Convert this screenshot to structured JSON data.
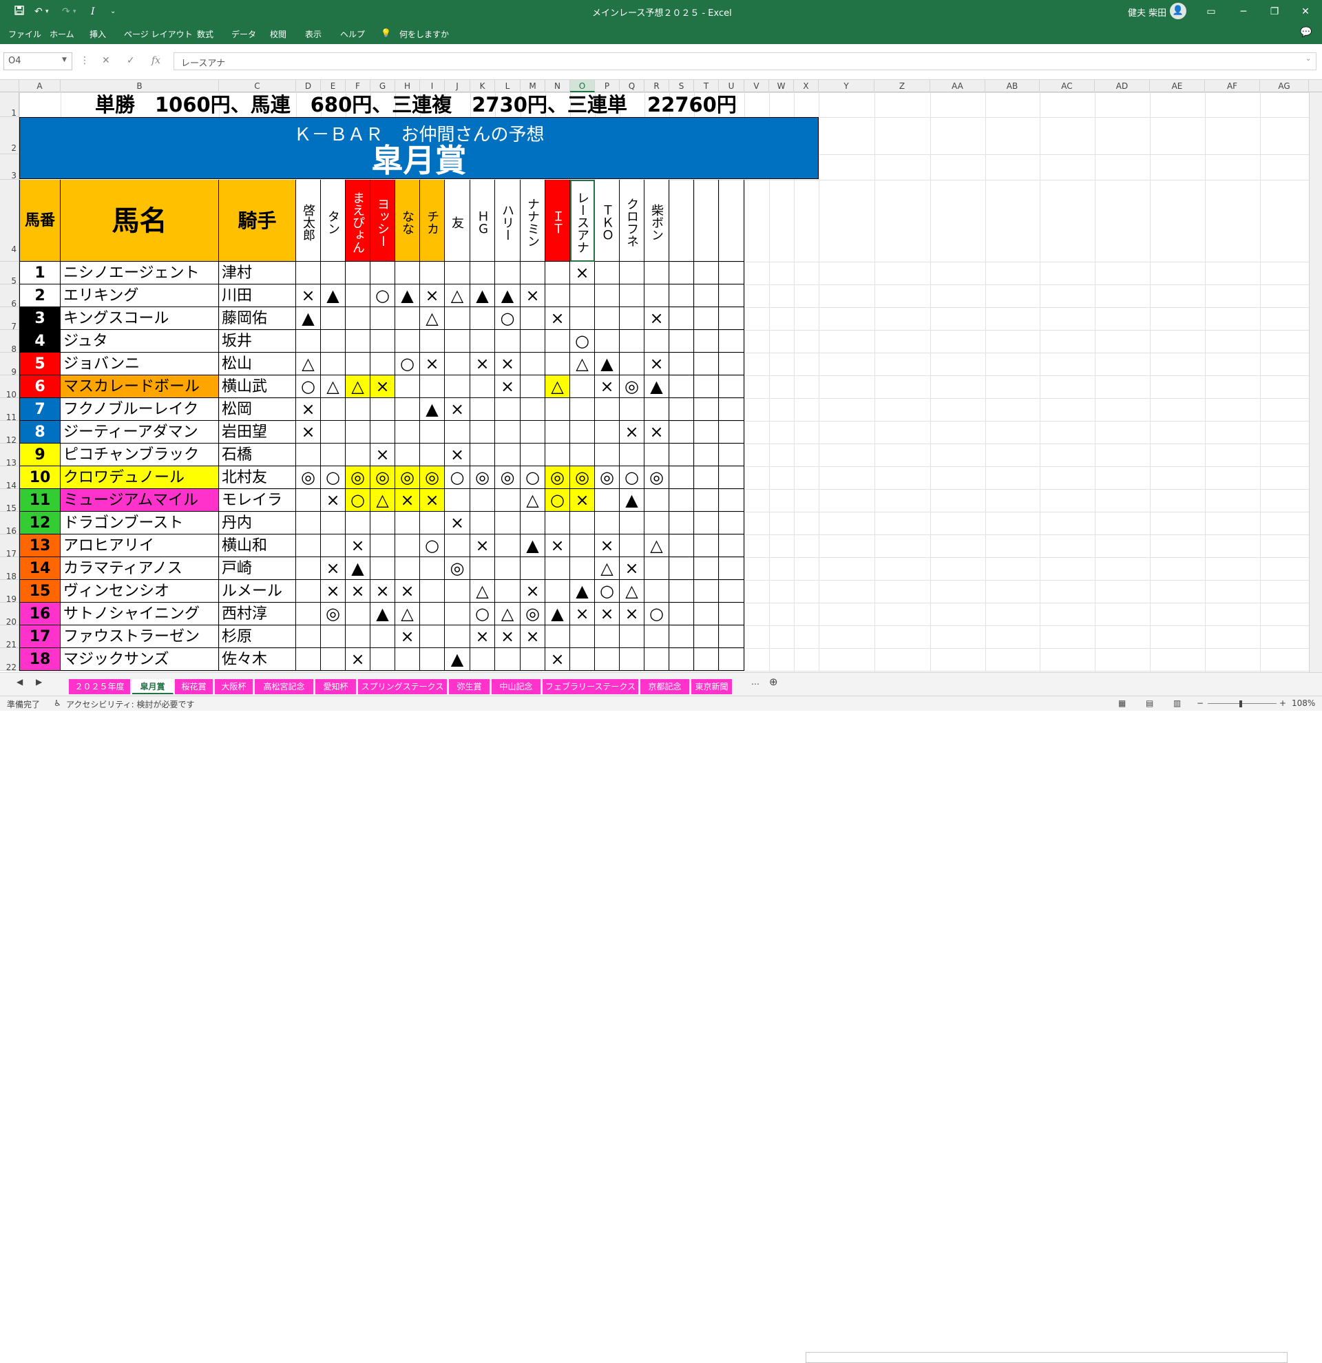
{
  "window": {
    "title": "メインレース予想２０２５ - Excel",
    "user": "健夫 柴田",
    "avatar_icon": "person-icon"
  },
  "qat": {
    "save_icon": "save-icon",
    "undo_icon": "undo-icon",
    "redo_icon": "redo-icon",
    "italic": "I"
  },
  "ribbon_tabs": [
    "ファイル",
    "ホーム",
    "挿入",
    "ページ レイアウト",
    "数式",
    "データ",
    "校閲",
    "表示",
    "ヘルプ",
    "何をしますか"
  ],
  "formula": {
    "name_box": "O4",
    "content": "レースアナ",
    "fx": "fx"
  },
  "columns": [
    "A",
    "B",
    "C",
    "D",
    "E",
    "F",
    "G",
    "H",
    "I",
    "J",
    "K",
    "L",
    "M",
    "N",
    "O",
    "P",
    "Q",
    "R",
    "S",
    "T",
    "U",
    "V",
    "W",
    "X",
    "Y",
    "Z",
    "AA",
    "AB",
    "AC",
    "AD",
    "AE",
    "AF",
    "AG"
  ],
  "rows": [
    "1",
    "2",
    "3",
    "4",
    "5",
    "6",
    "7",
    "8",
    "9",
    "10",
    "11",
    "12",
    "13",
    "14",
    "15",
    "16",
    "17",
    "18",
    "19",
    "20",
    "21",
    "22"
  ],
  "sheet": {
    "result_line": "単勝　1060円、馬連　680円、三連複　2730円、三連単　22760円",
    "subtitle": "Ｋ－ＢＡＲ　お仲間さんの予想",
    "race": "皐月賞",
    "hdr_num": "馬番",
    "hdr_name": "馬名",
    "hdr_jockey": "騎手",
    "predictors": [
      "啓太郎",
      "タン",
      "まえぴょん",
      "ヨッシー",
      "なな",
      "チカ",
      "友",
      "ＨＧ",
      "ハリー",
      "ナナミン",
      "ＩＴ",
      "レースアナ",
      "ＴＫＯ",
      "クロフネ",
      "柴ボン"
    ],
    "predictor_colors": [
      "#ffffff",
      "#ffffff",
      "#ff0000",
      "#ff0000",
      "#ffc000",
      "#ffc000",
      "#ffffff",
      "#ffffff",
      "#ffffff",
      "#ffffff",
      "#ff0000",
      "#ffffff",
      "#ffffff",
      "#ffffff",
      "#ffffff"
    ],
    "horses": [
      {
        "num": "1",
        "name": "ニシノエージェント",
        "jockey": "津村",
        "num_bg": "#ffffff",
        "num_fg": "#000000",
        "name_bg": "#ffffff",
        "marks": [
          "",
          "",
          "",
          "",
          "",
          "",
          "",
          "",
          "",
          "",
          "",
          "×",
          "",
          "",
          ""
        ]
      },
      {
        "num": "2",
        "name": "エリキング",
        "jockey": "川田",
        "num_bg": "#ffffff",
        "num_fg": "#000000",
        "name_bg": "#ffffff",
        "marks": [
          "×",
          "▲",
          "",
          "○",
          "▲",
          "×",
          "△",
          "▲",
          "▲",
          "×",
          "",
          "",
          "",
          "",
          ""
        ]
      },
      {
        "num": "3",
        "name": "キングスコール",
        "jockey": "藤岡佑",
        "num_bg": "#000000",
        "num_fg": "#ffffff",
        "name_bg": "#ffffff",
        "marks": [
          "▲",
          "",
          "",
          "",
          "",
          "△",
          "",
          "",
          "○",
          "",
          "×",
          "",
          "",
          "",
          "×"
        ]
      },
      {
        "num": "4",
        "name": "ジュタ",
        "jockey": "坂井",
        "num_bg": "#000000",
        "num_fg": "#ffffff",
        "name_bg": "#ffffff",
        "marks": [
          "",
          "",
          "",
          "",
          "",
          "",
          "",
          "",
          "",
          "",
          "",
          "○",
          "",
          "",
          ""
        ]
      },
      {
        "num": "5",
        "name": "ジョバンニ",
        "jockey": "松山",
        "num_bg": "#ff0000",
        "num_fg": "#ffffff",
        "name_bg": "#ffffff",
        "marks": [
          "△",
          "",
          "",
          "",
          "○",
          "×",
          "",
          "×",
          "×",
          "",
          "",
          "△",
          "▲",
          "",
          "×"
        ]
      },
      {
        "num": "6",
        "name": "マスカレードボール",
        "jockey": "横山武",
        "num_bg": "#ff0000",
        "num_fg": "#ffffff",
        "name_bg": "#ffa500",
        "marks": [
          "○",
          "△",
          "△",
          "×",
          "",
          "",
          "",
          "",
          "×",
          "",
          "△",
          "",
          "×",
          "◎",
          "▲"
        ]
      },
      {
        "num": "7",
        "name": "フクノブルーレイク",
        "jockey": "松岡",
        "num_bg": "#0070c0",
        "num_fg": "#ffffff",
        "name_bg": "#ffffff",
        "marks": [
          "×",
          "",
          "",
          "",
          "",
          "▲",
          "×",
          "",
          "",
          "",
          "",
          "",
          "",
          "",
          ""
        ]
      },
      {
        "num": "8",
        "name": "ジーティーアダマン",
        "jockey": "岩田望",
        "num_bg": "#0070c0",
        "num_fg": "#ffffff",
        "name_bg": "#ffffff",
        "marks": [
          "×",
          "",
          "",
          "",
          "",
          "",
          "",
          "",
          "",
          "",
          "",
          "",
          "",
          "×",
          "×"
        ]
      },
      {
        "num": "9",
        "name": "ピコチャンブラック",
        "jockey": "石橋",
        "num_bg": "#ffff00",
        "num_fg": "#000000",
        "name_bg": "#ffffff",
        "marks": [
          "",
          "",
          "",
          "×",
          "",
          "",
          "×",
          "",
          "",
          "",
          "",
          "",
          "",
          "",
          ""
        ]
      },
      {
        "num": "10",
        "name": "クロワデュノール",
        "jockey": "北村友",
        "num_bg": "#ffff00",
        "num_fg": "#000000",
        "name_bg": "#ffff00",
        "marks": [
          "◎",
          "○",
          "◎",
          "◎",
          "◎",
          "◎",
          "○",
          "◎",
          "◎",
          "○",
          "◎",
          "◎",
          "◎",
          "○",
          "◎"
        ]
      },
      {
        "num": "11",
        "name": "ミュージアムマイル",
        "jockey": "モレイラ",
        "num_bg": "#33cc33",
        "num_fg": "#000000",
        "name_bg": "#ff33cc",
        "marks": [
          "",
          "×",
          "○",
          "△",
          "×",
          "×",
          "",
          "",
          "",
          "△",
          "○",
          "×",
          "",
          "▲",
          ""
        ]
      },
      {
        "num": "12",
        "name": "ドラゴンブースト",
        "jockey": "丹内",
        "num_bg": "#33cc33",
        "num_fg": "#000000",
        "name_bg": "#ffffff",
        "marks": [
          "",
          "",
          "",
          "",
          "",
          "",
          "×",
          "",
          "",
          "",
          "",
          "",
          "",
          "",
          ""
        ]
      },
      {
        "num": "13",
        "name": "アロヒアリイ",
        "jockey": "横山和",
        "num_bg": "#ff6600",
        "num_fg": "#000000",
        "name_bg": "#ffffff",
        "marks": [
          "",
          "",
          "×",
          "",
          "",
          "○",
          "",
          "×",
          "",
          "▲",
          "×",
          "",
          "×",
          "",
          "△"
        ]
      },
      {
        "num": "14",
        "name": "カラマティアノス",
        "jockey": "戸崎",
        "num_bg": "#ff6600",
        "num_fg": "#000000",
        "name_bg": "#ffffff",
        "marks": [
          "",
          "×",
          "▲",
          "",
          "",
          "",
          "◎",
          "",
          "",
          "",
          "",
          "",
          "△",
          "×",
          ""
        ]
      },
      {
        "num": "15",
        "name": "ヴィンセンシオ",
        "jockey": "ルメール",
        "num_bg": "#ff6600",
        "num_fg": "#000000",
        "name_bg": "#ffffff",
        "marks": [
          "",
          "×",
          "×",
          "×",
          "×",
          "",
          "",
          "△",
          "",
          "×",
          "",
          "▲",
          "○",
          "△",
          ""
        ]
      },
      {
        "num": "16",
        "name": "サトノシャイニング",
        "jockey": "西村淳",
        "num_bg": "#ff33cc",
        "num_fg": "#000000",
        "name_bg": "#ffffff",
        "marks": [
          "",
          "◎",
          "",
          "▲",
          "△",
          "",
          "",
          "○",
          "△",
          "◎",
          "▲",
          "×",
          "×",
          "×",
          "○"
        ]
      },
      {
        "num": "17",
        "name": "ファウストラーゼン",
        "jockey": "杉原",
        "num_bg": "#ff33cc",
        "num_fg": "#000000",
        "name_bg": "#ffffff",
        "marks": [
          "",
          "",
          "",
          "",
          "×",
          "",
          "",
          "×",
          "×",
          "×",
          "",
          "",
          "",
          "",
          ""
        ]
      },
      {
        "num": "18",
        "name": "マジックサンズ",
        "jockey": "佐々木",
        "num_bg": "#ff33cc",
        "num_fg": "#000000",
        "name_bg": "#ffffff",
        "marks": [
          "",
          "",
          "×",
          "",
          "",
          "",
          "▲",
          "",
          "",
          "",
          "×",
          "",
          "",
          "",
          ""
        ]
      }
    ],
    "highlights": [
      {
        "row": 5,
        "cols": [
          2,
          3
        ]
      },
      {
        "row": 5,
        "cols": [
          10
        ]
      },
      {
        "row": 9,
        "cols": [
          2,
          3,
          4,
          5,
          10,
          11
        ]
      },
      {
        "row": 10,
        "cols": [
          2,
          3,
          4,
          5,
          10,
          11
        ]
      }
    ]
  },
  "sheet_tabs": [
    "２０２５年度",
    "皐月賞",
    "桜花賞",
    "大阪杯",
    "高松宮記念",
    "愛知杯",
    "スプリングステークス",
    "弥生賞",
    "中山記念",
    "フェブラリーステークス",
    "京都記念",
    "東京新聞"
  ],
  "active_tab": 1,
  "status": {
    "ready": "準備完了",
    "accessibility": "アクセシビリティ: 検討が必要です",
    "zoom": "108%"
  }
}
